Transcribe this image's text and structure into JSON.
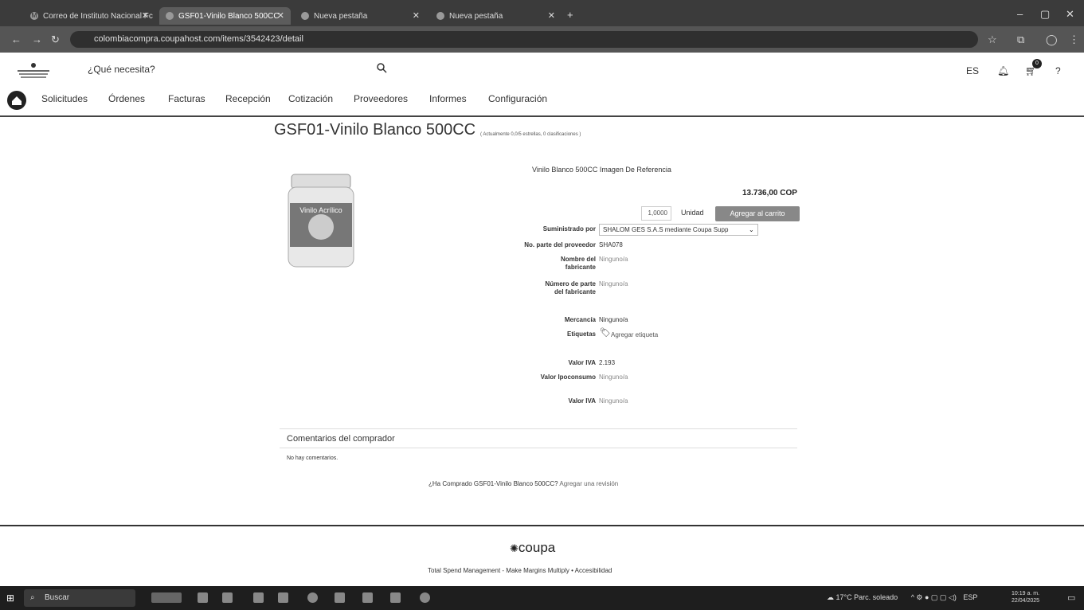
{
  "browser": {
    "tabs": [
      {
        "label": "Correo de Instituto Nacional Fc",
        "icon": "gmail-icon",
        "active": false
      },
      {
        "label": "GSF01-Vinilo Blanco 500CC",
        "icon": "coupa-favicon",
        "active": true
      },
      {
        "label": "Nueva pestaña",
        "icon": "newtab-icon",
        "active": false
      },
      {
        "label": "Nueva pestaña",
        "icon": "newtab-icon",
        "active": false
      }
    ],
    "url": "colombiacompra.coupahost.com/items/3542423/detail"
  },
  "header": {
    "search_placeholder": "¿Qué necesita?",
    "lang": "ES",
    "cart_count": "0",
    "help": "?"
  },
  "nav": {
    "items": [
      "Solicitudes",
      "Órdenes",
      "Facturas",
      "Recepción",
      "Cotización",
      "Proveedores",
      "Informes",
      "Configuración"
    ]
  },
  "product": {
    "title": "GSF01-Vinilo Blanco 500CC",
    "rating": "( Actualmente 0,0/5 estrellas, 0 clasificaciones )",
    "image_caption": "Vinilo Blanco 500CC Imagen De Referencia",
    "image_label": "Vinilo Acrílico",
    "price": "13.736,00 COP",
    "quantity": "1,0000",
    "unit": "Unidad",
    "add_to_cart": "Agregar al carrito",
    "fields": [
      {
        "label": "Suministrado por",
        "value": "SHALOM GES S.A.S mediante Coupa Supp"
      },
      {
        "label": "No. parte del proveedor",
        "value": "SHA078"
      },
      {
        "label": "Nombre del fabricante",
        "value": "Ninguno/a"
      },
      {
        "label": "Número de parte del fabricante",
        "value": "Ninguno/a"
      },
      {
        "label": "Mercancía",
        "value": "Ninguno/a"
      },
      {
        "label": "Etiquetas",
        "value": "Agregar etiqueta"
      },
      {
        "label": "Valor IVA",
        "value": "2.193"
      },
      {
        "label": "Valor Ipoconsumo",
        "value": "Ninguno/a"
      },
      {
        "label": "Valor IVA",
        "value": "Ninguno/a"
      }
    ]
  },
  "comments": {
    "title": "Comentarios del comprador",
    "empty": "No hay comentarios.",
    "review_question": "¿Ha Comprado GSF01-Vinilo Blanco 500CC?",
    "review_link": "Agregar una revisión"
  },
  "footer": {
    "brand": "coupa",
    "links": "Total Spend Management - Make Margins Multiply  •  Accesibilidad"
  },
  "taskbar": {
    "search": "Buscar",
    "weather": "17°C  Parc. soleado",
    "lang": "ESP",
    "time": "10:19 a. m.",
    "date": "22/04/2025"
  }
}
